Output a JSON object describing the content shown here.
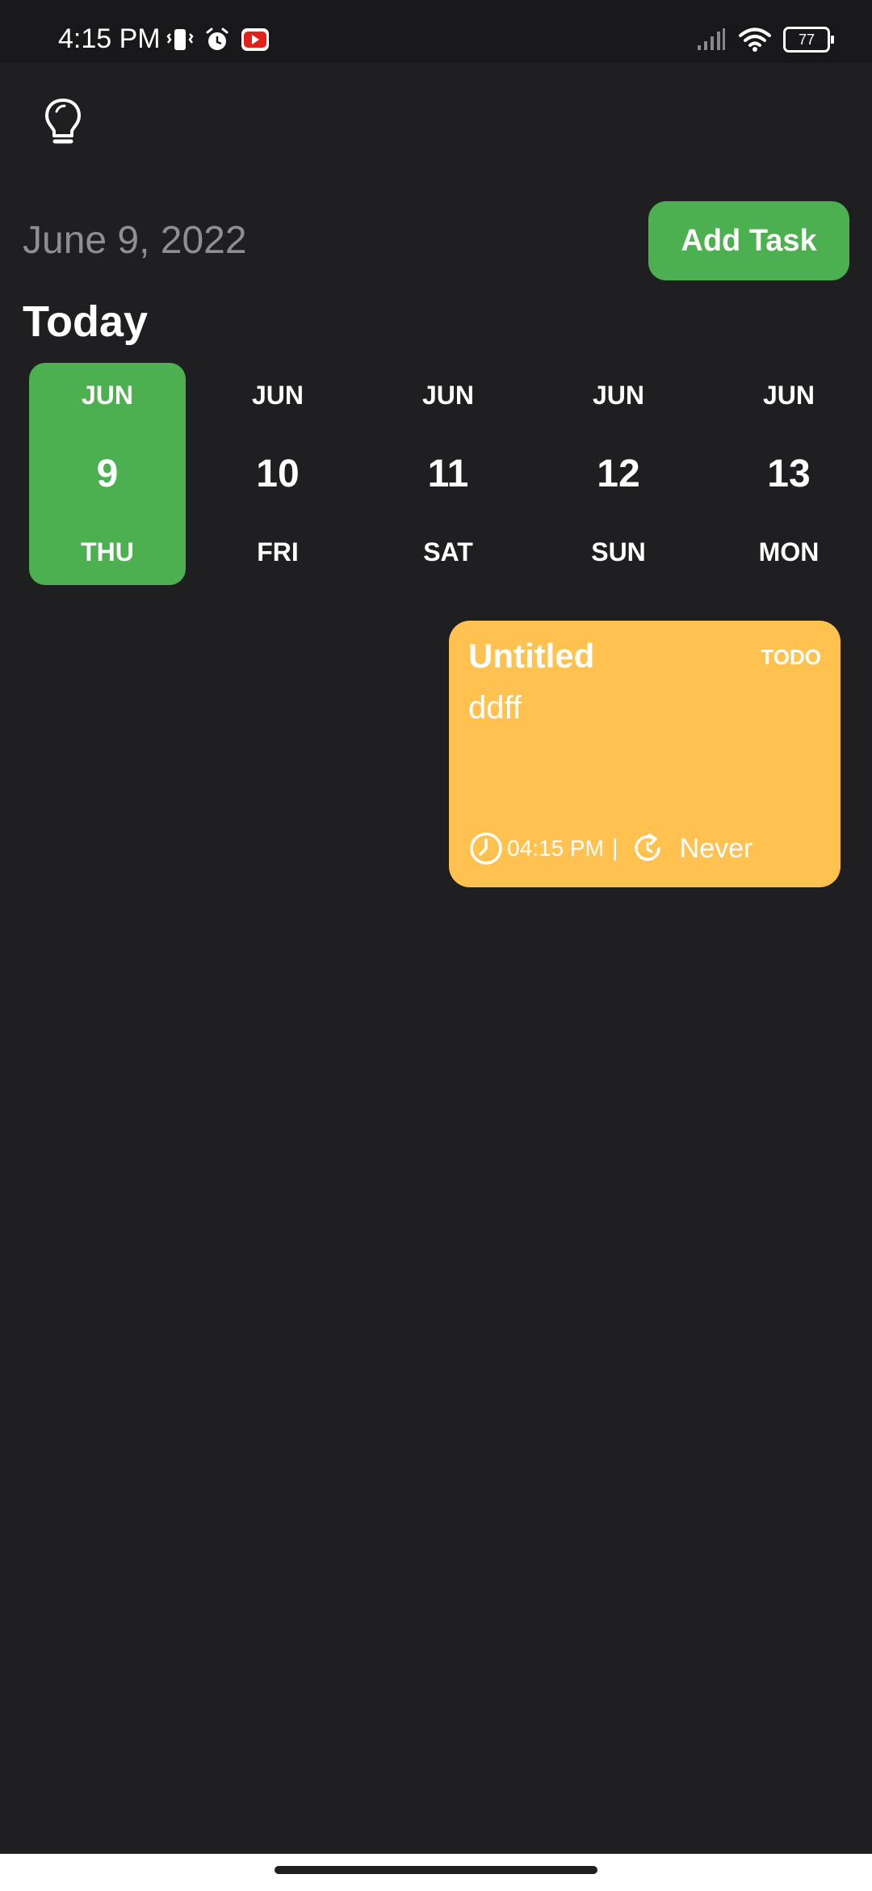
{
  "status_bar": {
    "time": "4:15 PM",
    "battery": "77"
  },
  "header": {
    "date": "June 9, 2022",
    "today": "Today",
    "add_task_label": "Add Task"
  },
  "date_strip": [
    {
      "month": "JUN",
      "day": "9",
      "weekday": "THU",
      "selected": true
    },
    {
      "month": "JUN",
      "day": "10",
      "weekday": "FRI"
    },
    {
      "month": "JUN",
      "day": "11",
      "weekday": "SAT"
    },
    {
      "month": "JUN",
      "day": "12",
      "weekday": "SUN"
    },
    {
      "month": "JUN",
      "day": "13",
      "weekday": "MON"
    }
  ],
  "task": {
    "title": "Untitled",
    "status": "TODO",
    "note": "ddff",
    "time": "04:15 PM",
    "separator": "|",
    "repeat": "Never"
  },
  "colors": {
    "background": "#1f1f21",
    "accent": "#4caf50",
    "task_card": "#ffc14f",
    "muted_text": "#8e8e93"
  }
}
